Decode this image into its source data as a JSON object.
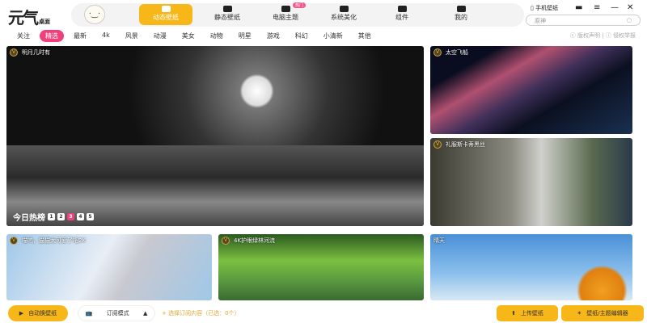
{
  "app": {
    "logo": "元气",
    "logo_sub": "桌面"
  },
  "nav": [
    {
      "label": "动态壁纸"
    },
    {
      "label": "静态壁纸"
    },
    {
      "label": "电脑主题",
      "badge": "热门"
    },
    {
      "label": "系统美化"
    },
    {
      "label": "组件"
    },
    {
      "label": "我的"
    }
  ],
  "window": {
    "mobile": "手机壁纸",
    "search_placeholder": "原神",
    "copyright": "版权声明",
    "report": "侵权举报"
  },
  "categories": [
    "关注",
    "精选",
    "最新",
    "4k",
    "风景",
    "动漫",
    "美女",
    "动物",
    "明星",
    "游戏",
    "科幻",
    "小清新",
    "其他"
  ],
  "active_category": "精选",
  "tiles": {
    "main": "明月几时有",
    "right1": "太空飞船",
    "right2": "礼服斯卡蒂黑丝",
    "b1": "喵呜，猫猫太可爱了吧2K",
    "b2": "4K护眼绿林河流",
    "b3": "晴天"
  },
  "hot": {
    "label": "今日热榜",
    "pages": [
      "1",
      "2",
      "3",
      "4",
      "5"
    ],
    "current": "3"
  },
  "footer": {
    "auto": "自动换壁纸",
    "mode": "订阅模式",
    "select": "+ 选择订阅内容（已选：0个）",
    "upload": "上传壁纸",
    "editor": "壁纸/主题编辑器"
  }
}
